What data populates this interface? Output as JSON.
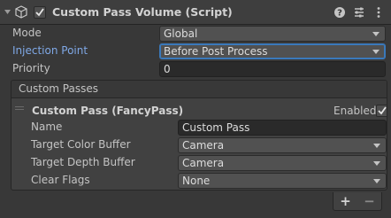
{
  "component": {
    "title": "Custom Pass Volume (Script)",
    "enabled": true
  },
  "fields": {
    "mode": {
      "label": "Mode",
      "value": "Global"
    },
    "injection_point": {
      "label": "Injection Point",
      "value": "Before Post Process"
    },
    "priority": {
      "label": "Priority",
      "value": "0"
    }
  },
  "custom_passes": {
    "header": "Custom Passes",
    "items": [
      {
        "title": "Custom Pass (FancyPass)",
        "enabled_label": "Enabled",
        "enabled": true,
        "name": {
          "label": "Name",
          "value": "Custom Pass"
        },
        "target_color_buffer": {
          "label": "Target Color Buffer",
          "value": "Camera"
        },
        "target_depth_buffer": {
          "label": "Target Depth Buffer",
          "value": "Camera"
        },
        "clear_flags": {
          "label": "Clear Flags",
          "value": "None"
        }
      }
    ],
    "add_label": "+",
    "remove_label": "−"
  },
  "colors": {
    "panel_bg": "#383838",
    "header_bg": "#3e3e3e",
    "focus_label": "#7fa8e6",
    "focus_border": "#3a79bb"
  },
  "icons": [
    "cube-script-icon",
    "checkmark-icon",
    "help-icon",
    "preset-sliders-icon",
    "kebab-menu-icon",
    "chevron-down-icon",
    "drag-handle-icon"
  ]
}
